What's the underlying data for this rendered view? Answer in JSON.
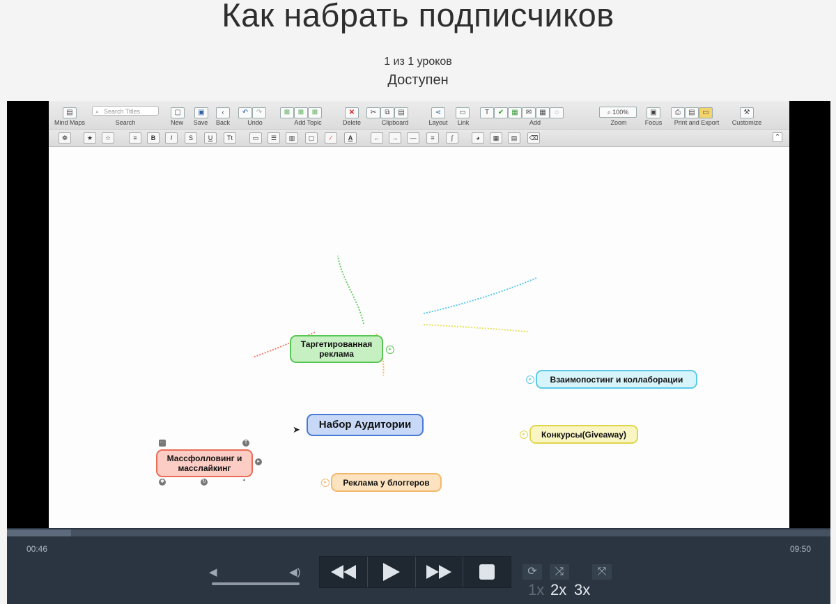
{
  "page": {
    "title": "Как набрать подписчиков",
    "lesson_count": "1 из 1 уроков",
    "status": "Доступен"
  },
  "app": {
    "toolbar": {
      "search_placeholder": "Search Titles",
      "buttons": [
        {
          "label": "Mind Maps",
          "icon": "mind-maps-icon"
        },
        {
          "label": "Search",
          "icon": "search-icon"
        },
        {
          "label": "New",
          "icon": "new-doc-icon"
        },
        {
          "label": "Save",
          "icon": "save-icon"
        },
        {
          "label": "Back",
          "icon": "back-arrow-icon"
        },
        {
          "label": "Undo",
          "icon": "undo-icon"
        },
        {
          "label": "Add Topic",
          "icon": "add-topic-icon"
        },
        {
          "label": "Delete",
          "icon": "delete-icon"
        },
        {
          "label": "Clipboard",
          "icon": "clipboard-icon"
        },
        {
          "label": "Layout",
          "icon": "layout-icon"
        },
        {
          "label": "Link",
          "icon": "link-icon"
        },
        {
          "label": "Add",
          "icon": "add-icon"
        },
        {
          "label": "Zoom",
          "icon": "zoom-icon"
        },
        {
          "label": "Focus",
          "icon": "focus-icon"
        },
        {
          "label": "Print and Export",
          "icon": "print-icon"
        },
        {
          "label": "Customize",
          "icon": "customize-icon"
        }
      ],
      "zoom_value": "100%"
    },
    "map": {
      "central": "Набор Аудитории",
      "nodes": [
        {
          "text": "Таргетированная реклама",
          "color": "#7fd67a"
        },
        {
          "text": "Взаимопостинг и коллаборации",
          "color": "#5cc9e8"
        },
        {
          "text": "Конкурсы(Giveaway)",
          "color": "#e8e05c"
        },
        {
          "text": "Реклама у блоггеров",
          "color": "#f2b86a"
        },
        {
          "text": "Массфолловинг и масслайкинг",
          "color": "#f07a6a"
        }
      ]
    }
  },
  "player": {
    "time_current": "00:46",
    "time_total": "09:50",
    "progress_fraction": 0.078,
    "volume_fraction": 1.0,
    "speeds": [
      "1x",
      "2x",
      "3x"
    ],
    "active_speed": "1x"
  }
}
